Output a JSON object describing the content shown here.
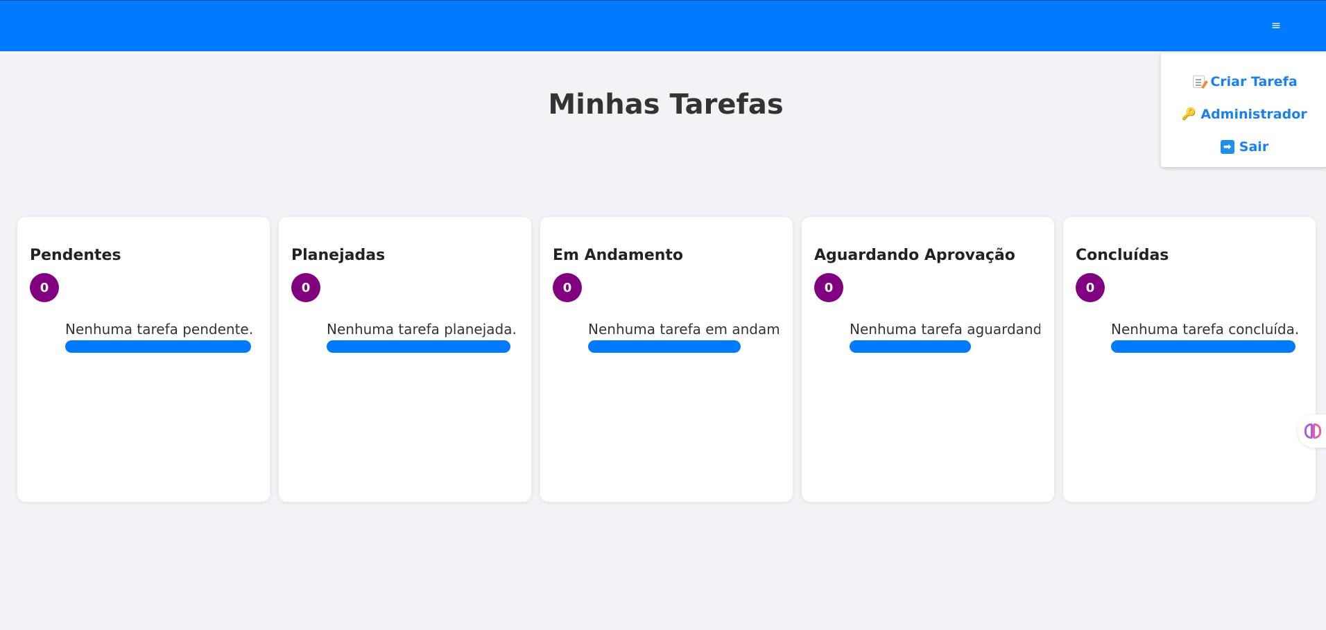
{
  "header": {
    "menu_icon": "menu-icon",
    "menu_glyph": "≡"
  },
  "menu": {
    "items": [
      {
        "label": "Criar Tarefa",
        "icon": "memo-icon"
      },
      {
        "label": "Administrador",
        "icon": "key-icon"
      },
      {
        "label": "Sair",
        "icon": "arrow-right-icon"
      }
    ]
  },
  "page": {
    "title": "Minhas Tarefas"
  },
  "columns": [
    {
      "title": "Pendentes",
      "count": "0",
      "empty_message": "Nenhuma tarefa pendente."
    },
    {
      "title": "Planejadas",
      "count": "0",
      "empty_message": "Nenhuma tarefa planejada."
    },
    {
      "title": "Em Andamento",
      "count": "0",
      "empty_message": "Nenhuma tarefa em andamento."
    },
    {
      "title": "Aguardando Aprovação",
      "count": "0",
      "empty_message": "Nenhuma tarefa aguardando aprovação."
    },
    {
      "title": "Concluídas",
      "count": "0",
      "empty_message": "Nenhuma tarefa concluída."
    }
  ],
  "side_widget": {
    "icon": "brain-icon"
  },
  "colors": {
    "header": "#007bff",
    "accent": "#1a7ff0",
    "badge": "#800080",
    "background": "#f3f3f7"
  }
}
